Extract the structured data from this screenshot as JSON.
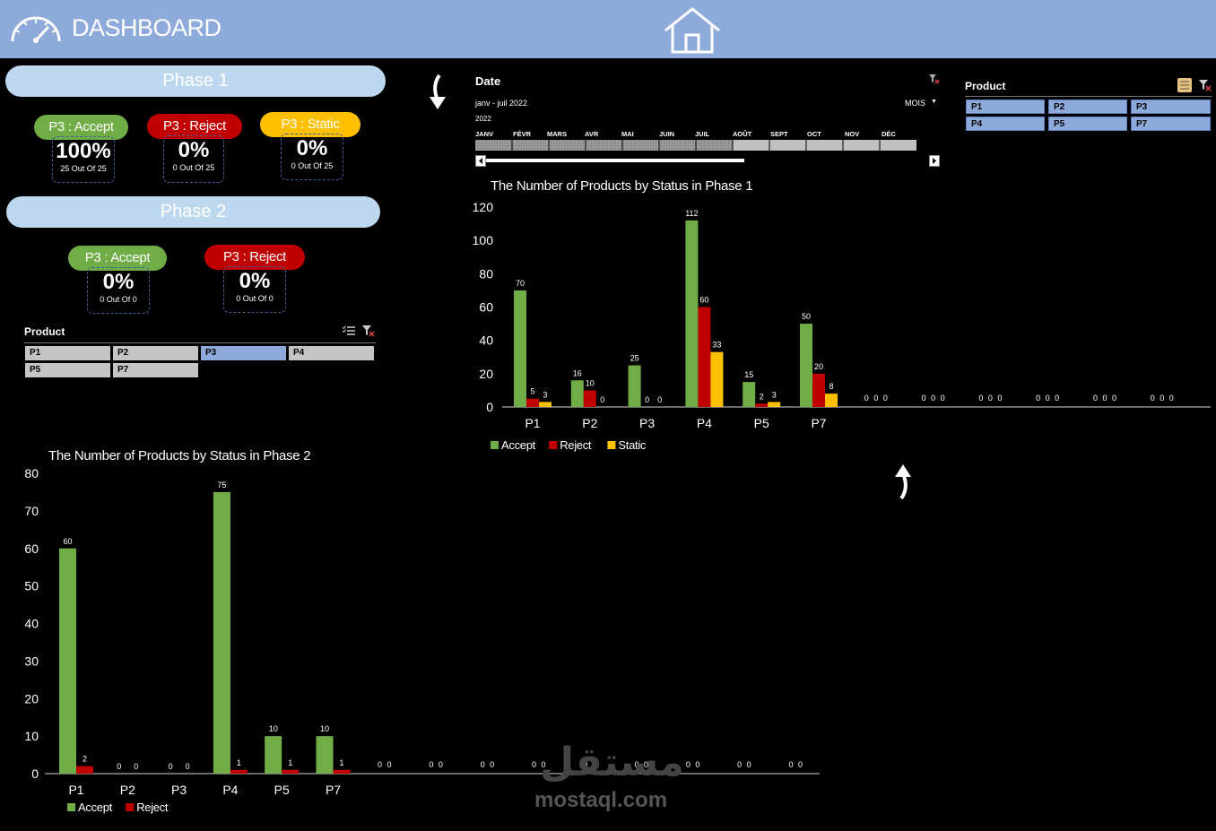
{
  "header": {
    "title": "DASHBOARD",
    "gauge_icon": "speedometer-icon",
    "home_icon": "home-icon"
  },
  "phase1": {
    "title": "Phase 1",
    "kpis": [
      {
        "label": "P3 : Accept",
        "color": "#70ad47",
        "pct": "100%",
        "sub": "25 Out Of 25"
      },
      {
        "label": "P3 : Reject",
        "color": "#c00000",
        "pct": "0%",
        "sub": "0 Out Of 25"
      },
      {
        "label": "P3 : Static",
        "color": "#ffc000",
        "pct": "0%",
        "sub": "0 Out Of 25"
      }
    ]
  },
  "phase2": {
    "title": "Phase 2",
    "kpis": [
      {
        "label": "P3 : Accept",
        "color": "#70ad47",
        "pct": "0%",
        "sub": "0 Out Of 0"
      },
      {
        "label": "P3 : Reject",
        "color": "#c00000",
        "pct": "0%",
        "sub": "0 Out Of 0"
      }
    ]
  },
  "left_slicer": {
    "title": "Product",
    "items": [
      "P1",
      "P2",
      "P3",
      "P4",
      "P5",
      "P7"
    ],
    "selected": "P3"
  },
  "right_slicer": {
    "title": "Product",
    "items": [
      "P1",
      "P2",
      "P3",
      "P4",
      "P5",
      "P7"
    ]
  },
  "timeline": {
    "title": "Date",
    "range": "janv - juil 2022",
    "year": "2022",
    "level": "MOIS",
    "months": [
      "JANV",
      "FÉVR",
      "MARS",
      "AVR",
      "MAI",
      "JUIN",
      "JUIL",
      "AOÛT",
      "SEPT",
      "OCT",
      "NOV",
      "DÉC"
    ]
  },
  "colors": {
    "accept": "#70ad47",
    "reject": "#c00000",
    "static": "#ffc000",
    "header_bg": "#8eaadb",
    "phase_bg": "#bdd7ee"
  },
  "chart_data": [
    {
      "type": "bar",
      "title": "The Number of Products by Status in Phase 1",
      "categories": [
        "P1",
        "P2",
        "P3",
        "P4",
        "P5",
        "P7"
      ],
      "series": [
        {
          "name": "Accept",
          "values": [
            70,
            16,
            25,
            112,
            15,
            50
          ]
        },
        {
          "name": "Reject",
          "values": [
            5,
            10,
            0,
            60,
            2,
            20
          ]
        },
        {
          "name": "Static",
          "values": [
            3,
            0,
            0,
            33,
            3,
            8
          ]
        }
      ],
      "ylim": [
        0,
        120
      ],
      "yticks": [
        0,
        20,
        40,
        60,
        80,
        100,
        120
      ],
      "legend": "bottom-left",
      "extra_zero_labels": [
        "0 0 0",
        "0 0 0",
        "0 0 0",
        "0 0 0",
        "0 0 0",
        "0 0 0",
        "0"
      ]
    },
    {
      "type": "bar",
      "title": "The Number of Products by Status in Phase 2",
      "categories": [
        "P1",
        "P2",
        "P3",
        "P4",
        "P5",
        "P7"
      ],
      "series": [
        {
          "name": "Accept",
          "values": [
            60,
            0,
            0,
            75,
            10,
            10
          ]
        },
        {
          "name": "Reject",
          "values": [
            2,
            0,
            0,
            1,
            1,
            1
          ]
        }
      ],
      "ylim": [
        0,
        80
      ],
      "yticks": [
        0,
        10,
        20,
        30,
        40,
        50,
        60,
        70,
        80
      ],
      "legend": "bottom-left",
      "extra_zero_labels": [
        "0 0",
        "0 0",
        "0 0",
        "0 0",
        "0 0",
        "0 0",
        "0 0",
        "0 0",
        "0 0"
      ]
    }
  ],
  "watermark": {
    "arabic": "مستقل",
    "latin": "mostaql.com"
  }
}
